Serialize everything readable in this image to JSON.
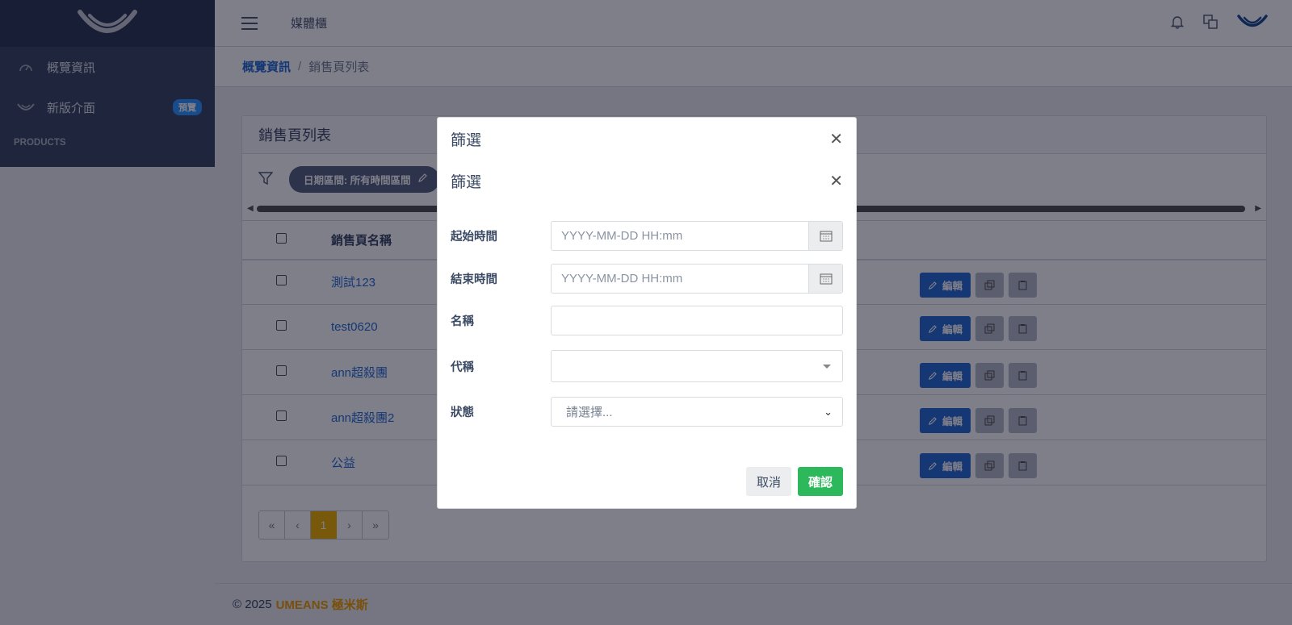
{
  "header": {
    "title": "媒體櫃"
  },
  "sidebar": {
    "items": [
      {
        "label": "概覽資訊",
        "icon": "speedometer-icon"
      },
      {
        "label": "新版介面",
        "icon": "brand-smile-icon",
        "badge": "預覽"
      }
    ],
    "section_title": "PRODUCTS"
  },
  "breadcrumb": {
    "home": "概覽資訊",
    "separator": "/",
    "current": "銷售頁列表"
  },
  "card": {
    "title": "銷售頁列表",
    "filter_chip": "日期區間: 所有時間區間",
    "column_name": "銷售頁名稱",
    "rows": [
      {
        "name": "測試123"
      },
      {
        "name": "test0620"
      },
      {
        "name": "ann超殺團"
      },
      {
        "name": "ann超殺團2"
      },
      {
        "name": "公益"
      }
    ],
    "edit_label": "編輯",
    "pager": [
      "«",
      "‹",
      "1",
      "›",
      "»"
    ]
  },
  "footer": {
    "copyright": "© 2025",
    "brand": "UMEANS 極米斯"
  },
  "modal": {
    "outer_title": "篩選",
    "inner_title": "篩選",
    "fields": {
      "start_label": "起始時間",
      "start_placeholder": "YYYY-MM-DD HH:mm",
      "end_label": "結束時間",
      "end_placeholder": "YYYY-MM-DD HH:mm",
      "name_label": "名稱",
      "name_value": "",
      "code_label": "代稱",
      "code_value": "",
      "status_label": "狀態",
      "status_value": "請選擇..."
    },
    "cancel_label": "取消",
    "confirm_label": "確認"
  },
  "colors": {
    "sidebar": "#3c4b64",
    "primary": "#2a6fd0",
    "success": "#2eb85c",
    "warning": "#f0b000"
  }
}
